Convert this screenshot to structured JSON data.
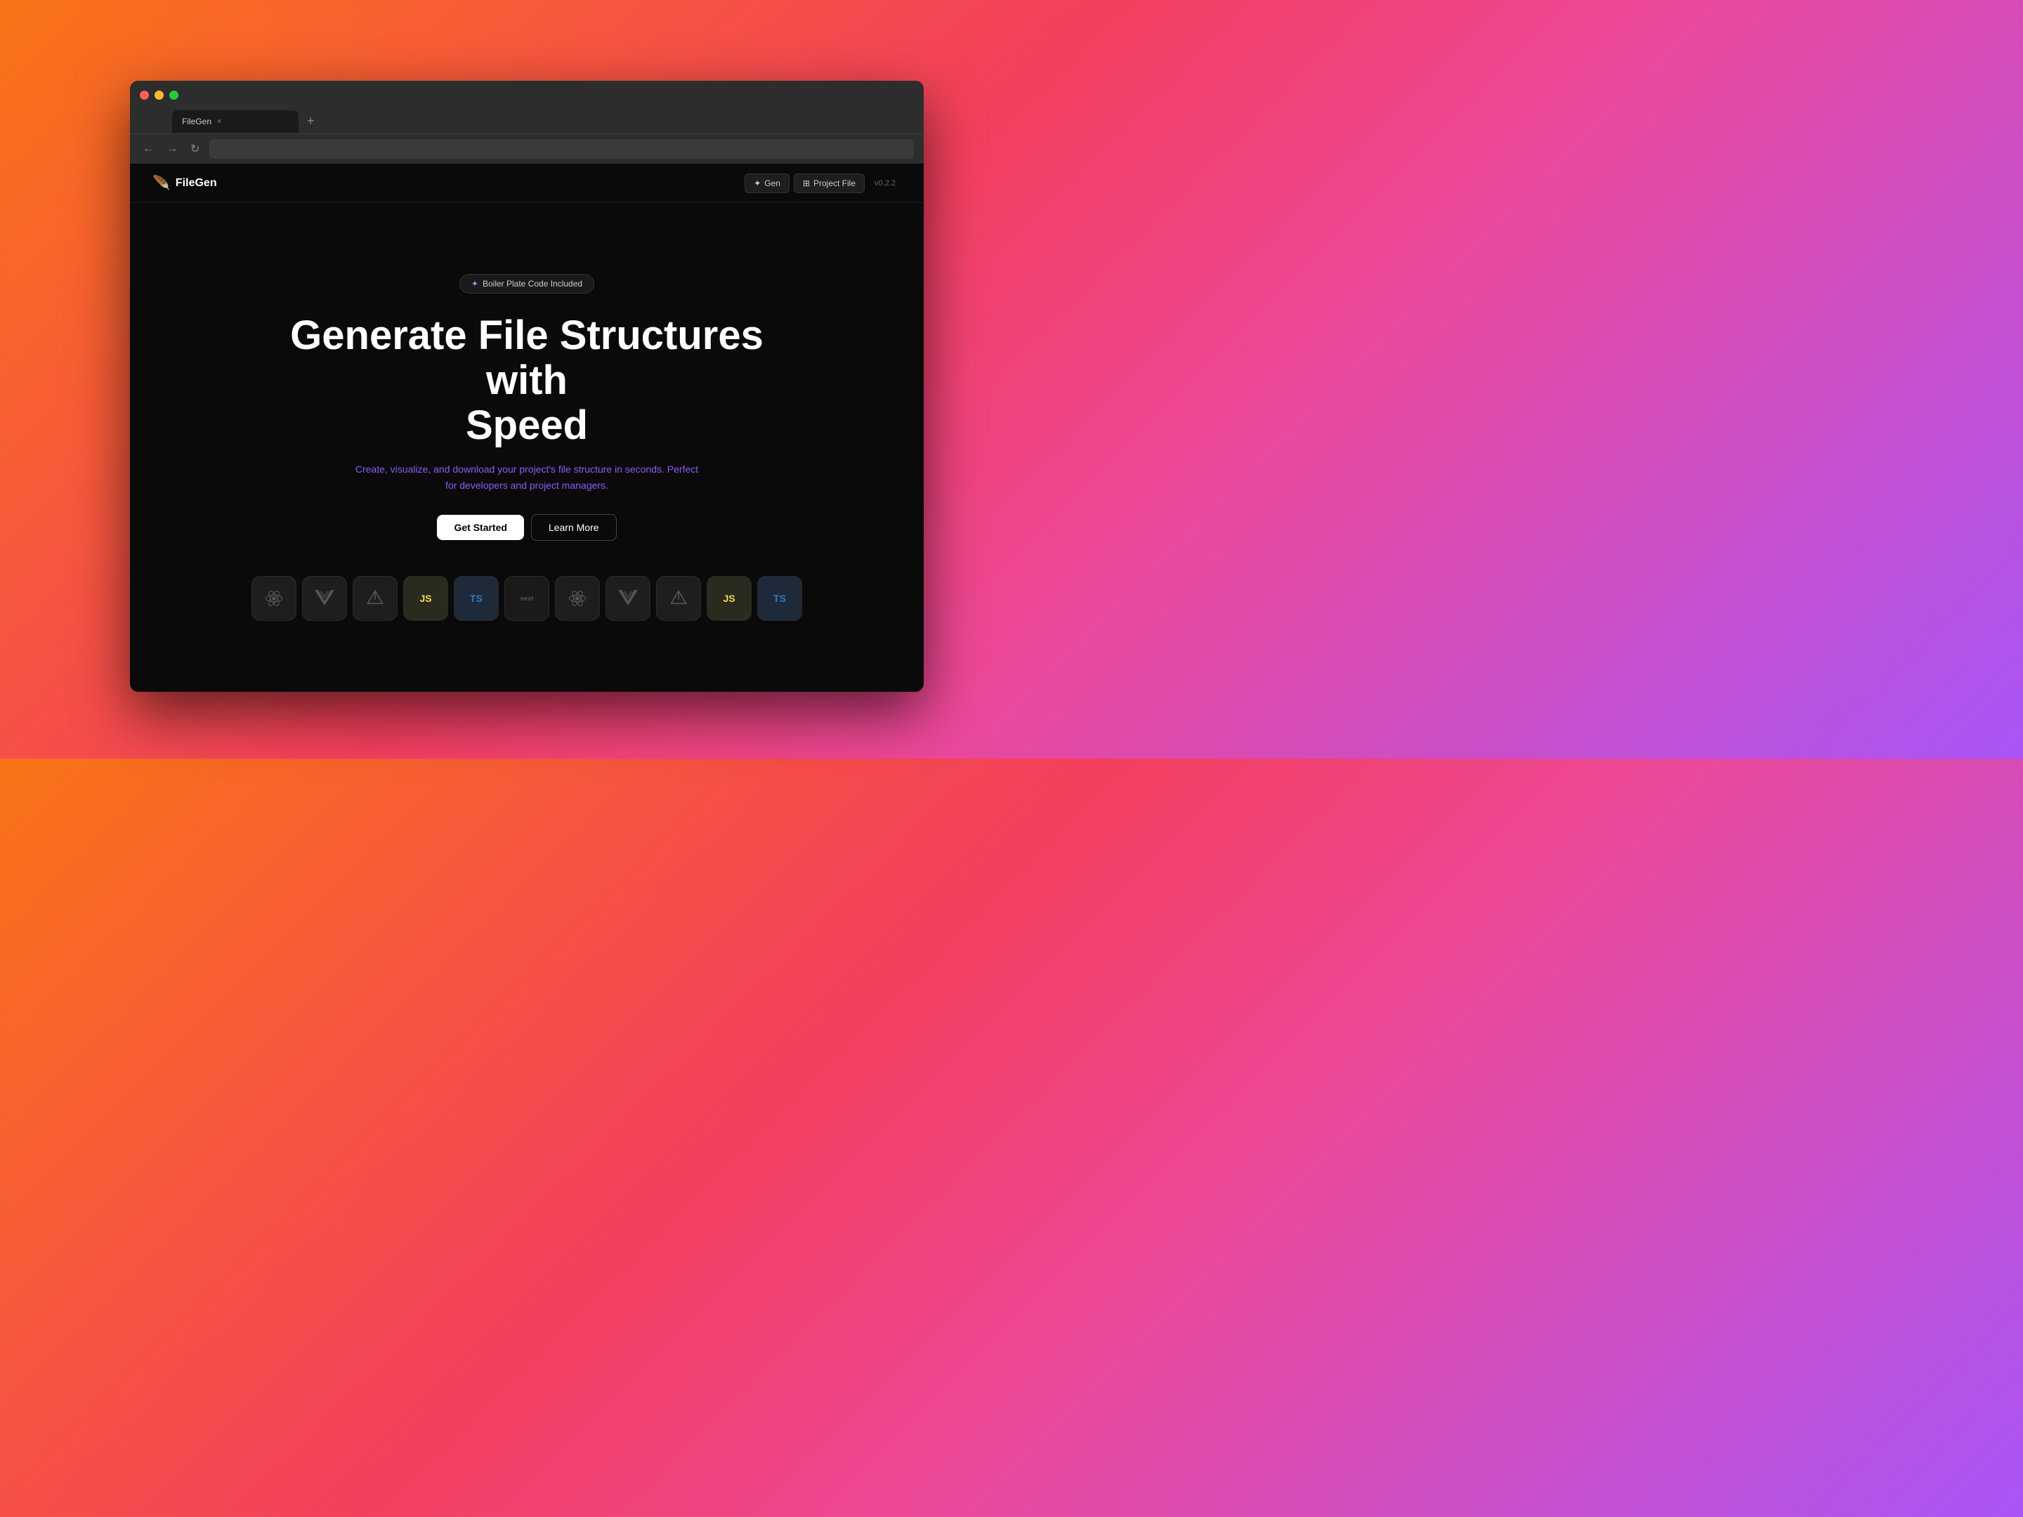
{
  "browser": {
    "tab_label": "FileGen",
    "tab_close": "×",
    "tab_new": "+",
    "nav_back": "←",
    "nav_forward": "→",
    "nav_refresh": "↻"
  },
  "app": {
    "logo_text_normal": "File",
    "logo_text_bold": "Gen",
    "nav_actions": [
      {
        "id": "gen",
        "icon": "✦",
        "label": "Gen"
      },
      {
        "id": "project-file",
        "icon": "⊞",
        "label": "Project File"
      }
    ],
    "nav_version": "v0.2.2"
  },
  "hero": {
    "badge_icon": "✦",
    "badge_text": "Boiler Plate Code Included",
    "title_line1": "Generate File Structures",
    "title_line2": "with",
    "title_line3": "Speed",
    "subtitle": "Create, visualize, and download your project's file structure in seconds. Perfect for developers and project managers.",
    "btn_primary": "Get Started",
    "btn_secondary": "Learn More"
  },
  "tech_icons": [
    {
      "id": "react-1",
      "type": "react",
      "label": "React"
    },
    {
      "id": "vue-1",
      "type": "vue",
      "label": "Vue"
    },
    {
      "id": "vite-1",
      "type": "vite",
      "label": "Vite"
    },
    {
      "id": "js-1",
      "type": "js",
      "label": "JS"
    },
    {
      "id": "ts-1",
      "type": "ts",
      "label": "TS"
    },
    {
      "id": "next-1",
      "type": "next",
      "label": "Next"
    },
    {
      "id": "react-2",
      "type": "react",
      "label": "React"
    },
    {
      "id": "vue-2",
      "type": "vue",
      "label": "Vue"
    },
    {
      "id": "vite-2",
      "type": "vite",
      "label": "Vite"
    },
    {
      "id": "js-2",
      "type": "js",
      "label": "JS"
    },
    {
      "id": "ts-2",
      "type": "ts",
      "label": "TS"
    }
  ],
  "colors": {
    "bg_gradient_start": "#f97316",
    "bg_gradient_end": "#a855f7",
    "app_bg": "#0a0a0a",
    "accent": "#a78bfa",
    "subtitle_color": "#8b5cf6"
  }
}
